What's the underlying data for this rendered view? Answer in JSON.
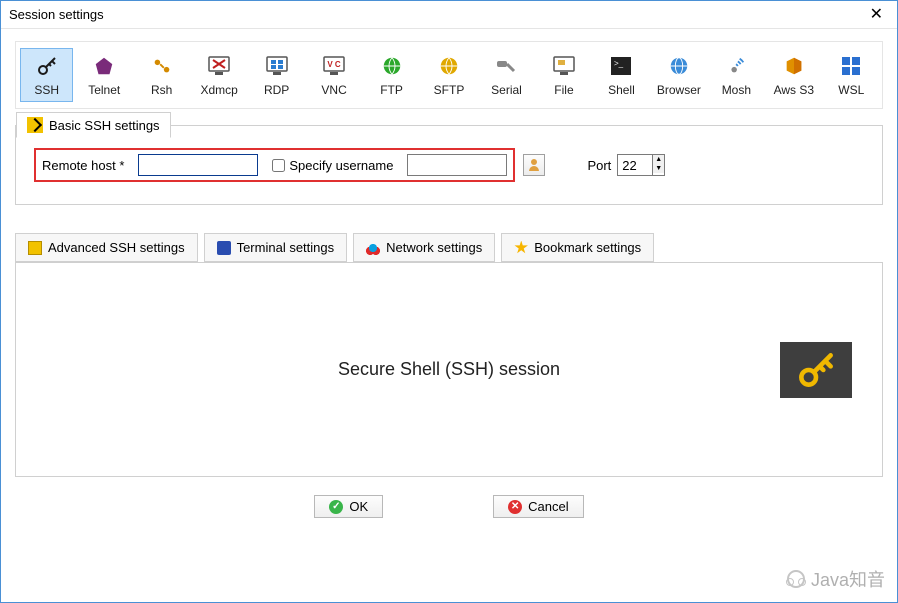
{
  "window": {
    "title": "Session settings"
  },
  "protocols": {
    "items": [
      {
        "id": "ssh",
        "label": "SSH",
        "selected": true
      },
      {
        "id": "telnet",
        "label": "Telnet"
      },
      {
        "id": "rsh",
        "label": "Rsh"
      },
      {
        "id": "xdmcp",
        "label": "Xdmcp"
      },
      {
        "id": "rdp",
        "label": "RDP"
      },
      {
        "id": "vnc",
        "label": "VNC"
      },
      {
        "id": "ftp",
        "label": "FTP"
      },
      {
        "id": "sftp",
        "label": "SFTP"
      },
      {
        "id": "serial",
        "label": "Serial"
      },
      {
        "id": "file",
        "label": "File"
      },
      {
        "id": "shell",
        "label": "Shell"
      },
      {
        "id": "browser",
        "label": "Browser"
      },
      {
        "id": "mosh",
        "label": "Mosh"
      },
      {
        "id": "awss3",
        "label": "Aws S3"
      },
      {
        "id": "wsl",
        "label": "WSL"
      }
    ]
  },
  "basic_tab": {
    "label": "Basic SSH settings",
    "remote_host_label": "Remote host *",
    "remote_host_value": "",
    "specify_username_label": "Specify username",
    "specify_username_checked": false,
    "username_value": "",
    "port_label": "Port",
    "port_value": "22"
  },
  "tabs2": {
    "advanced": "Advanced SSH settings",
    "terminal": "Terminal settings",
    "network": "Network settings",
    "bookmark": "Bookmark settings"
  },
  "panel": {
    "title": "Secure Shell (SSH) session"
  },
  "buttons": {
    "ok": "OK",
    "cancel": "Cancel"
  },
  "watermark": "Java知音"
}
